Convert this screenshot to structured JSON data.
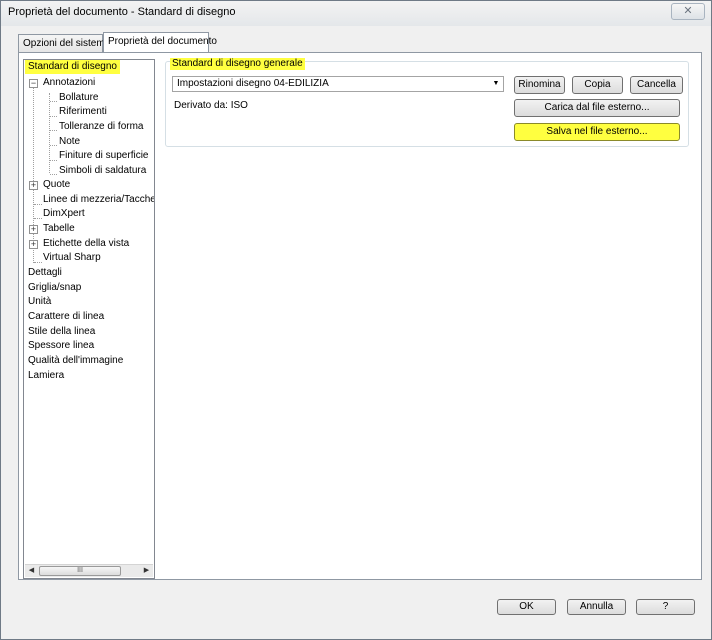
{
  "window": {
    "title": "Proprietà del documento - Standard di disegno",
    "close_glyph": "✕"
  },
  "tabs": [
    {
      "label": "Opzioni del sistema",
      "active": false
    },
    {
      "label": "Proprietà del documento",
      "active": true
    }
  ],
  "tree": {
    "items": [
      "Standard di disegno",
      "Annotazioni",
      "Bollature",
      "Riferimenti",
      "Tolleranze di forma",
      "Note",
      "Finiture di superficie",
      "Simboli di saldatura",
      "Quote",
      "Linee di mezzeria/Tacche",
      "DimXpert",
      "Tabelle",
      "Etichette della vista",
      "Virtual Sharp",
      "Dettagli",
      "Griglia/snap",
      "Unità",
      "Carattere di linea",
      "Stile della linea",
      "Spessore linea",
      "Qualità dell'immagine",
      "Lamiera"
    ],
    "scroll_grip": "III"
  },
  "group": {
    "legend": "Standard di disegno generale",
    "combo_value": "Impostazioni disegno 04-EDILIZIA",
    "derived_label": "Derivato da: ISO",
    "buttons": {
      "rename": "Rinomina",
      "copy": "Copia",
      "delete": "Cancella",
      "load_external": "Carica dal file esterno...",
      "save_external": "Salva nel file esterno..."
    }
  },
  "footer": {
    "ok": "OK",
    "cancel": "Annulla",
    "help": "?"
  },
  "colors": {
    "highlight": "#ffff40",
    "window_bg": "#f0f0f0"
  }
}
